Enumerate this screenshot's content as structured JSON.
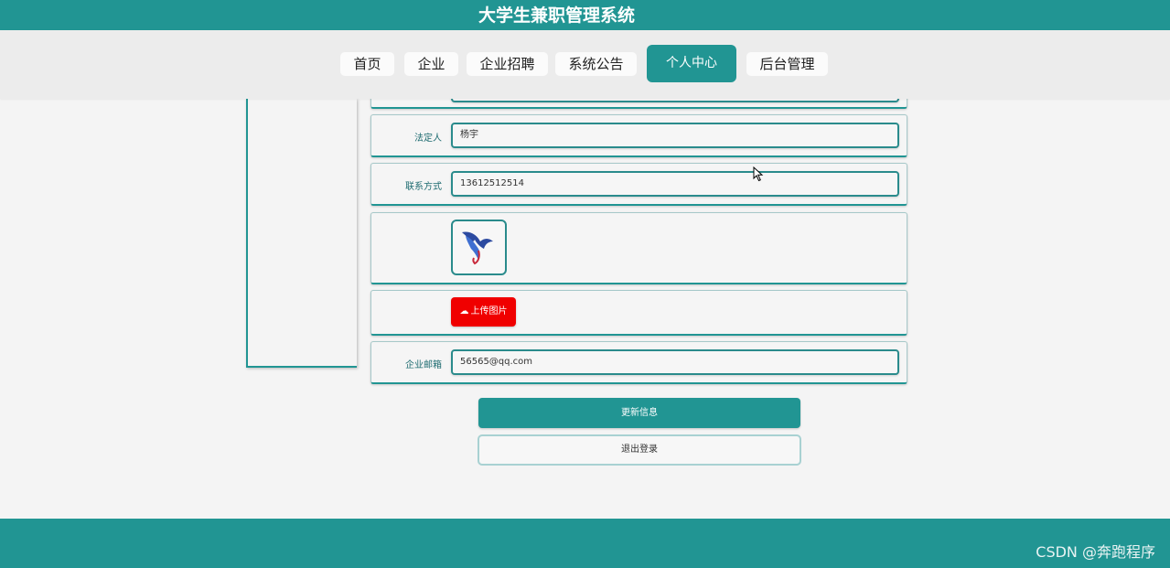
{
  "header": {
    "title": "大学生兼职管理系统"
  },
  "nav": {
    "items": [
      "首页",
      "企业",
      "企业招聘",
      "系统公告",
      "个人中心",
      "后台管理"
    ],
    "active": "个人中心"
  },
  "form": {
    "legal_person_label": "法定人",
    "legal_person_value": "杨宇",
    "contact_label": "联系方式",
    "contact_value": "13612512514",
    "upload_label": "上传图片",
    "email_label": "企业邮箱",
    "email_value": "56565@qq.com"
  },
  "actions": {
    "update_label": "更新信息",
    "logout_label": "退出登录"
  },
  "footer": {
    "watermark": "CSDN @奔跑程序"
  },
  "colors": {
    "primary": "#219593",
    "upload": "#f00000",
    "background": "#f4f4f4"
  },
  "icons": {
    "upload": "cloud-upload-icon",
    "logo": "bird-logo",
    "cursor": "mouse-pointer-icon"
  }
}
